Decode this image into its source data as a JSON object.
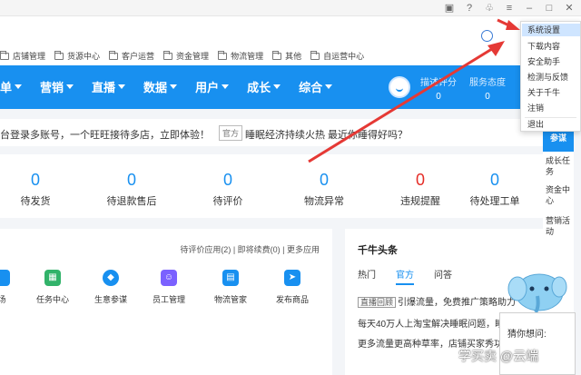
{
  "titlebar": {
    "icons": [
      "feedback-icon",
      "help-icon",
      "skin-icon",
      "menu-icon",
      "minimize-icon",
      "maximize-icon",
      "close-icon"
    ]
  },
  "shortcuts": [
    "店铺管理",
    "货源中心",
    "客户运营",
    "资金管理",
    "物流管理",
    "其他",
    "自运营中心"
  ],
  "nav": {
    "items": [
      "单",
      "营销",
      "直播",
      "数据",
      "用户",
      "成长",
      "综合"
    ],
    "stat1_label": "描述评分",
    "stat1_value": "0",
    "stat2_label": "服务态度",
    "stat2_value": "0"
  },
  "notice": {
    "text": "台登录多账号，一个旺旺接待多店，立即体验！",
    "tag": "官方",
    "news": "睡眠经济持续火热 最近你睡得好吗？"
  },
  "stats": [
    {
      "value": "0",
      "label": "待发货"
    },
    {
      "value": "0",
      "label": "待退款售后"
    },
    {
      "value": "0",
      "label": "待评价"
    },
    {
      "value": "0",
      "label": "物流异常"
    },
    {
      "value": "0",
      "label": "违规提醒"
    },
    {
      "value": "0",
      "label": "待处理工单"
    }
  ],
  "apps": {
    "links": "待评价应用(2) | 即将续费(0) | 更多应用",
    "items": [
      {
        "label": "场",
        "color": "#1890f0"
      },
      {
        "label": "任务中心",
        "color": "#32b36a"
      },
      {
        "label": "生意参谋",
        "color": "#1890f0"
      },
      {
        "label": "员工管理",
        "color": "#7b61ff"
      },
      {
        "label": "物流管家",
        "color": "#1890f0"
      },
      {
        "label": "发布商品",
        "color": "#1890f0"
      }
    ]
  },
  "news": {
    "title": "千牛头条",
    "tabs": [
      "热门",
      "官方",
      "问答"
    ],
    "line1_tag": "直播回顾",
    "line1": "引爆流量，免费推广策略助力",
    "line2": "每天40万人上淘宝解决睡眠问题，睡",
    "line3": "更多流量更高种草率，店铺买家秀功"
  },
  "rail": [
    "参谋",
    "成长任务",
    "资金中心",
    "营销活动"
  ],
  "menu": [
    "系统设置",
    "下载内容",
    "安全助手",
    "检测与反馈",
    "关于千牛",
    "注销",
    "退出"
  ],
  "chat": {
    "question": "猜你想问:"
  },
  "watermark": "学买卖 @云端",
  "colors": {
    "primary": "#1890f0",
    "alert": "#e52d27",
    "arrow": "#e53935"
  }
}
